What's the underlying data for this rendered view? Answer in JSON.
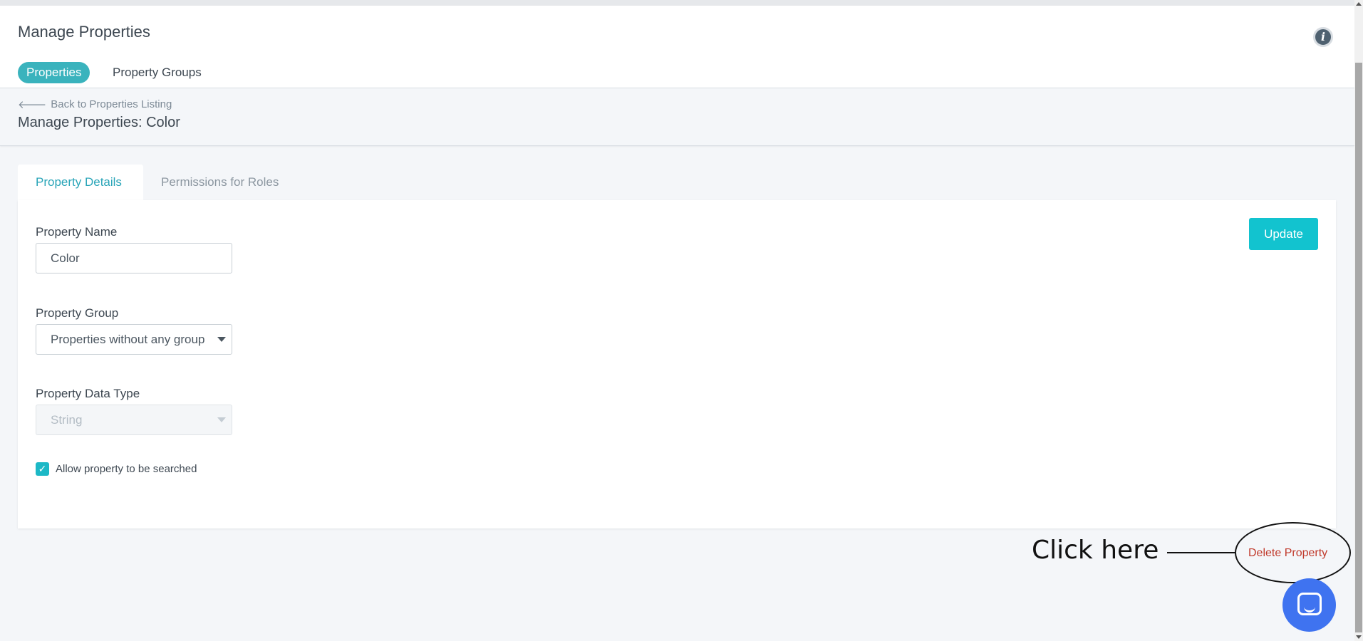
{
  "header": {
    "title": "Manage Properties",
    "tabs": [
      {
        "label": "Properties",
        "active": true
      },
      {
        "label": "Property Groups",
        "active": false
      }
    ],
    "info_icon": "info-icon"
  },
  "breadcrumb": {
    "back_label": "Back to Properties Listing",
    "title": "Manage Properties: Color"
  },
  "tabs": [
    {
      "label": "Property Details",
      "active": true
    },
    {
      "label": "Permissions for Roles",
      "active": false
    }
  ],
  "form": {
    "property_name": {
      "label": "Property Name",
      "value": "Color"
    },
    "property_group": {
      "label": "Property Group",
      "selected": "Properties without any group"
    },
    "property_data_type": {
      "label": "Property Data Type",
      "selected": "String",
      "disabled": true
    },
    "searchable": {
      "label": "Allow property to be searched",
      "checked": true
    },
    "update_label": "Update"
  },
  "delete_label": "Delete Property",
  "annotation": {
    "text": "Click here"
  },
  "colors": {
    "accent": "#3ab3bd",
    "update_button": "#12c3cf",
    "delete_link": "#c0392b",
    "chat_bubble": "#3f73f0"
  }
}
